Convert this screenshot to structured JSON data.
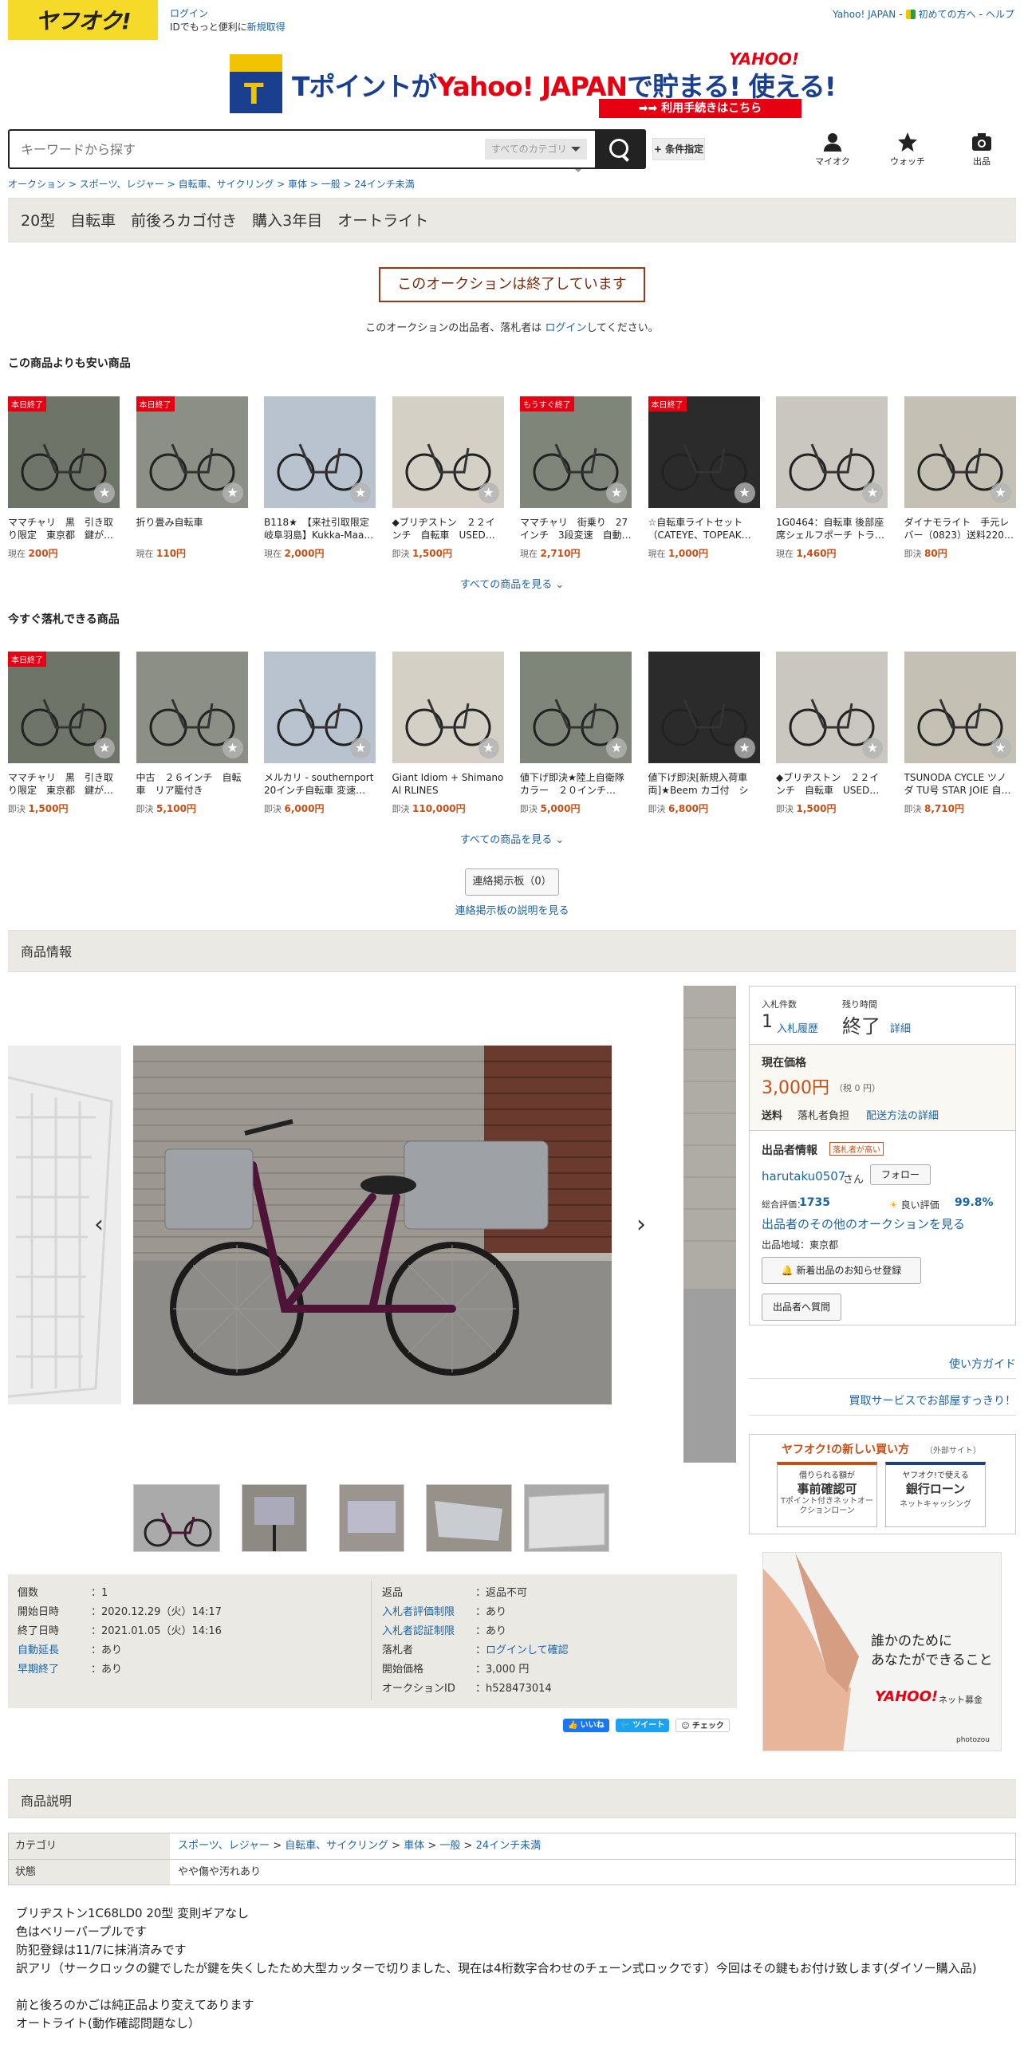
{
  "header": {
    "logo": "ヤフオク!",
    "login": "ログイン",
    "login_sub_prefix": "IDでもっと便利に",
    "signup": "新規取得",
    "top_links": [
      "Yahoo! JAPAN",
      "-",
      "初めての方へ",
      "-",
      "ヘルプ"
    ]
  },
  "banner": {
    "copy_a": "Tポイントが",
    "copy_b": "Yahoo! JAPAN",
    "copy_c": "で貯まる! 使える!",
    "logo": "YAHOO!",
    "cta": "利用手続きはこちら"
  },
  "search": {
    "placeholder": "キーワードから探す",
    "category": "すべてのカテゴリ",
    "condition": "+ 条件指定"
  },
  "nav": [
    {
      "label": "マイオク",
      "icon": "user-icon"
    },
    {
      "label": "ウォッチ",
      "icon": "star-icon"
    },
    {
      "label": "出品",
      "icon": "camera-icon"
    }
  ],
  "breadcrumb": "オークション > スポーツ、レジャー > 自転車、サイクリング > 車体 > 一般 > 24インチ未満",
  "title": "20型　自転車　前後ろカゴ付き　購入3年目　オートライト",
  "ended": {
    "label": "このオークションは終了しています",
    "note_a": "このオークションの出品者、落札者は",
    "note_link": "ログイン",
    "note_b": "してください。"
  },
  "cheaper": {
    "heading": "この商品よりも安い商品",
    "items": [
      {
        "tag": "本日終了",
        "title": "ママチャリ　黒　引き取り限定　東京都　鍵が…",
        "plabel": "現在",
        "price": "200円"
      },
      {
        "tag": "本日終了",
        "title": "折り畳み自転車",
        "plabel": "現在",
        "price": "110円"
      },
      {
        "tag": "",
        "title": "B118★　【来社引取限定 岐阜羽島】Kukka-Maa…",
        "plabel": "現在",
        "price": "2,000円"
      },
      {
        "tag": "",
        "title": "◆ブリヂストン　２２インチ　自転車　USED…",
        "plabel": "即決",
        "price": "1,500円"
      },
      {
        "tag": "もうすぐ終了",
        "title": "ママチャリ　街乗り　27インチ　3段変速　自動…",
        "plabel": "現在",
        "price": "2,710円"
      },
      {
        "tag": "本日終了",
        "title": "☆自転車ライトセット（CATEYE、TOPEAK…",
        "plabel": "現在",
        "price": "1,000円"
      },
      {
        "tag": "",
        "title": "1G0464：自転車 後部座席シェルフポーチ トラ…",
        "plabel": "現在",
        "price": "1,460円"
      },
      {
        "tag": "",
        "title": "ダイナモライト　手元レバー（0823）送料220…",
        "plabel": "即決",
        "price": "80円"
      }
    ],
    "more": "すべての商品を見る"
  },
  "buynow": {
    "heading": "今すぐ落札できる商品",
    "items": [
      {
        "tag": "本日終了",
        "title": "ママチャリ　黒　引き取り限定　東京都　鍵が…",
        "plabel": "即決",
        "price": "1,500円"
      },
      {
        "tag": "",
        "title": "中古　２６インチ　自転車　リア籠付き",
        "plabel": "即決",
        "price": "5,100円"
      },
      {
        "tag": "",
        "title": "メルカリ - southernport　20インチ自転車 変速…",
        "plabel": "即決",
        "price": "6,000円"
      },
      {
        "tag": "",
        "title": "Giant Idiom + Shimano Al RLINES",
        "plabel": "即決",
        "price": "110,000円"
      },
      {
        "tag": "",
        "title": "値下げ即決★陸上自衛隊カラー　２０インチ…",
        "plabel": "即決",
        "price": "5,000円"
      },
      {
        "tag": "",
        "title": "値下げ即決[新規入荷車両]★Beem カゴ付　シマ…",
        "plabel": "即決",
        "price": "6,800円"
      },
      {
        "tag": "",
        "title": "◆ブリヂストン　２２インチ　自転車　USED…",
        "plabel": "即決",
        "price": "1,500円"
      },
      {
        "tag": "",
        "title": "TSUNODA CYCLE ツノダ TU号 STAR JOIE 自…",
        "plabel": "即決",
        "price": "8,710円"
      }
    ],
    "more": "すべての商品を見る"
  },
  "bbs": {
    "button": "連絡掲示板（0）",
    "note": "連絡掲示板の説明を見る"
  },
  "info_heading": "商品情報",
  "details": {
    "left": [
      {
        "k": "個数",
        "v": "1",
        "link": false
      },
      {
        "k": "開始日時",
        "v": "2020.12.29（火）14:17",
        "link": false
      },
      {
        "k": "終了日時",
        "v": "2021.01.05（火）14:16",
        "link": false
      },
      {
        "k": "自動延長",
        "v": "あり",
        "link": true
      },
      {
        "k": "早期終了",
        "v": "あり",
        "link": true
      }
    ],
    "right": [
      {
        "k": "返品",
        "v": "返品不可",
        "klink": false,
        "vlink": false
      },
      {
        "k": "入札者評価制限",
        "v": "あり",
        "klink": true,
        "vlink": false
      },
      {
        "k": "入札者認証制限",
        "v": "あり",
        "klink": true,
        "vlink": false
      },
      {
        "k": "落札者",
        "v": "ログインして確認",
        "klink": false,
        "vlink": true
      },
      {
        "k": "開始価格",
        "v": "3,000 円",
        "klink": false,
        "vlink": false
      },
      {
        "k": "オークションID",
        "v": "h528473014",
        "klink": false,
        "vlink": false
      }
    ]
  },
  "social": [
    "いいね",
    "ツイート",
    "チェック"
  ],
  "panel": {
    "bid_label": "入札件数",
    "bid_count": "1",
    "bid_history": "入札履歴",
    "remain_label": "残り時間",
    "remain": "終了",
    "remain_detail": "詳細",
    "price_label": "現在価格",
    "price": "3,000円",
    "tax": "（税 0 円）",
    "ship_label": "送料",
    "ship_value": "落札者負担",
    "ship_link": "配送方法の詳細",
    "seller_label": "出品者情報",
    "seller_badge": "落札者が高い",
    "seller_name": "harutaku0507",
    "seller_suffix": "さん",
    "follow": "フォロー",
    "rating_label": "総合評価：",
    "rating": "1735",
    "good_label": "良い評価",
    "good": "99.8%",
    "other_auctions": "出品者のその他のオークションを見る",
    "region": "出品地域：東京都",
    "notify": "新着出品のお知らせ登録",
    "question": "出品者へ質問",
    "guide": "使い方ガイド",
    "kaitori": "買取サービスでお部屋すっきり！",
    "newbuy_title": "ヤフオク!の新しい買い方",
    "newbuy_sub": "（外部サイト）",
    "card1_top": "借りられる額が",
    "card1_main": "事前確認可",
    "card1_sub": "Tポイント付きネットオークションローン",
    "card2_top": "ヤフオク!で使える",
    "card2_main": "銀行ローン",
    "card2_sub": "ネットキャッシング",
    "ad_line1": "誰かのために",
    "ad_line2": "あなたができること",
    "ad_logo": "YAHOO!",
    "ad_logo2": "ネット募金",
    "ad_credit": "photozou"
  },
  "desc_heading": "商品説明",
  "category_table": {
    "cat_label": "カテゴリ",
    "cat_path": [
      "スポーツ、レジャー",
      ">",
      "自転車、サイクリング",
      ">",
      "車体",
      ">",
      "一般",
      ">",
      "24インチ未満"
    ],
    "state_label": "状態",
    "state": "やや傷や汚れあり"
  },
  "description": [
    "ブリヂストン1C68LD0 20型 変則ギアなし",
    "色はベリーパープルです",
    "防犯登録は11/7に抹消済みです",
    "訳アリ（サークロックの鍵でしたが鍵を失くしたため大型カッターで切りました、現在は4桁数字合わせのチェーン式ロックです）今回はその鍵もお付け致します(ダイソー購入品)",
    "",
    "前と後ろのかごは純正品より変えてあります",
    "オートライト(動作確認問題なし）"
  ],
  "colors": {
    "accent": "#1a64a8",
    "price": "#c84e14",
    "ended_border": "#9b3a12",
    "brand_yellow": "#f6da2a"
  }
}
